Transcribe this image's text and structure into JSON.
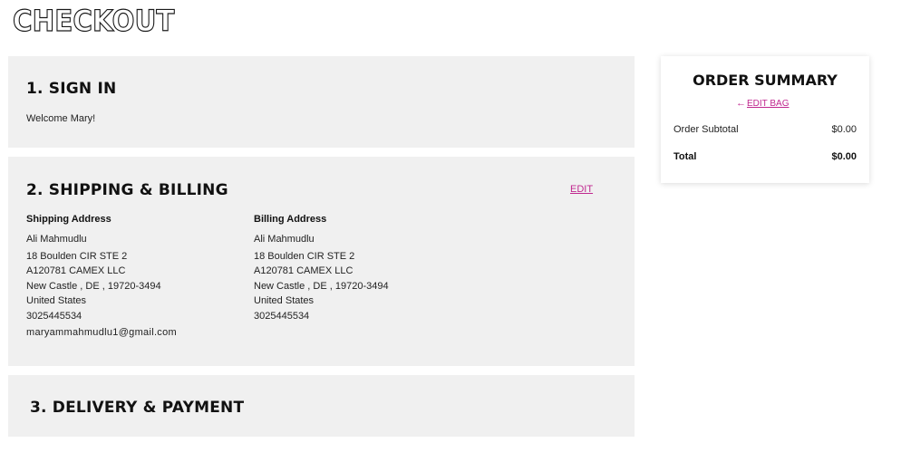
{
  "page": {
    "title": "CHECKOUT"
  },
  "sign_in": {
    "heading": "1. SIGN IN",
    "welcome": "Welcome Mary!"
  },
  "shipping_billing": {
    "heading": "2. SHIPPING & BILLING",
    "edit_label": "EDIT",
    "shipping": {
      "title": "Shipping Address",
      "name": "Ali Mahmudlu",
      "lines": [
        "18 Boulden CIR STE 2",
        "A120781 CAMEX LLC",
        "New Castle , DE , 19720-3494",
        "United States",
        "3025445534"
      ],
      "email": "maryammahmudlu1@gmail.com"
    },
    "billing": {
      "title": "Billing Address",
      "name": "Ali Mahmudlu",
      "lines": [
        "18 Boulden CIR STE 2",
        "A120781 CAMEX LLC",
        "New Castle , DE , 19720-3494",
        "United States",
        "3025445534"
      ]
    }
  },
  "delivery_payment": {
    "heading": "3. DELIVERY & PAYMENT"
  },
  "order_summary": {
    "title": "ORDER SUMMARY",
    "edit_bag_label": "EDIT BAG",
    "subtotal_label": "Order Subtotal",
    "subtotal_value": "$0.00",
    "total_label": "Total",
    "total_value": "$0.00"
  },
  "colors": {
    "accent": "#c0288f",
    "panel": "#f0f0f0"
  }
}
